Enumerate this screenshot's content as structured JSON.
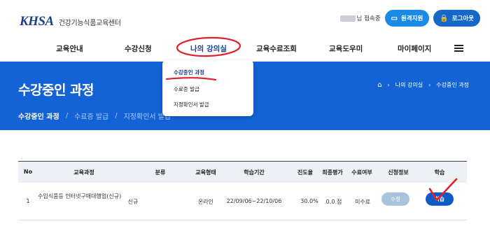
{
  "header": {
    "logo_mark": "KHSA",
    "logo_text": "건강기능식품교육센터",
    "user_suffix": "님 접속중",
    "remote_support_label": "원격지원",
    "logout_label": "로그아웃"
  },
  "gnb": {
    "items": [
      "교육안내",
      "수강신청",
      "나의 강의실",
      "교육수료조회",
      "교육도우미",
      "마이페이지"
    ],
    "active_index": 2
  },
  "dropdown": {
    "items": [
      "수강중인 과정",
      "수료증 발급",
      "지정확인서 발급"
    ],
    "active_index": 0
  },
  "hero": {
    "title": "수강중인 과정",
    "breadcrumb": [
      "나의 강의실",
      "수강중인 과정"
    ],
    "subnav": [
      "수강중인 과정",
      "수료증 발급",
      "지정확인서 발급"
    ]
  },
  "table": {
    "headers": [
      "No",
      "교육과정",
      "분류",
      "교육형태",
      "학습기간",
      "진도율",
      "최종평가",
      "수료여부",
      "신청정보",
      "학습"
    ],
    "rows": [
      {
        "no": "1",
        "course": "수입식품등 인터넷구매대행업(신규)",
        "category": "신규",
        "format": "온라인",
        "period": "22/09/06~22/10/06",
        "progress": "30.0%",
        "final_eval": "0.0 점",
        "completion": "미수료",
        "apply_info": "수정",
        "study": "학습"
      }
    ]
  },
  "colors": {
    "brand_blue": "#1363d6",
    "button_blue": "#1a8ae6",
    "study_button": "#0f5bc4",
    "annotation_red": "#e0202a"
  }
}
